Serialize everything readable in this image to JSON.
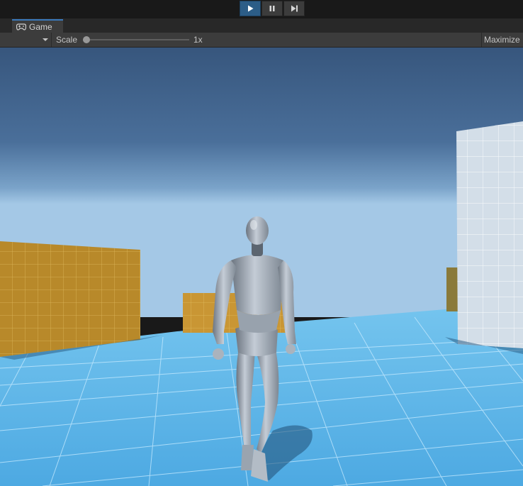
{
  "toolbar": {
    "buttons": [
      {
        "icon": "play-icon",
        "active": true
      },
      {
        "icon": "pause-icon",
        "active": false
      },
      {
        "icon": "step-icon",
        "active": false
      }
    ]
  },
  "tab": {
    "label": "Game",
    "icon": "gamepad-icon"
  },
  "gamebar": {
    "scale_label": "Scale",
    "scale_value": "1x",
    "scale_slider_fraction": 0.0,
    "maximize_label": "Maximize"
  },
  "colors": {
    "accent": "#2c5d87",
    "sky_top": "#3a5a82",
    "sky_horizon": "#9ec4e4",
    "ground": "#5fb6ea",
    "yellow_wall": "#b58a2c",
    "white_wall": "#d7e1ea",
    "robot": "#a7b0bb"
  }
}
